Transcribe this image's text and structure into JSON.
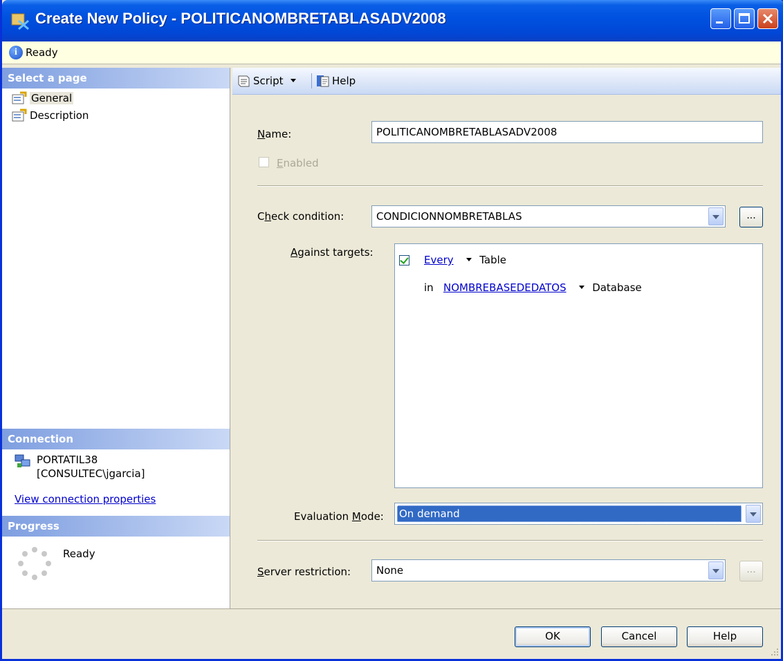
{
  "window": {
    "title": "Create New Policy - POLITICANOMBRETABLASADV2008",
    "status": "Ready"
  },
  "sidebar": {
    "select_page_header": "Select a page",
    "pages": [
      {
        "label": "General",
        "selected": true
      },
      {
        "label": "Description",
        "selected": false
      }
    ],
    "connection_header": "Connection",
    "connection_server": "PORTATIL38",
    "connection_user": "[CONSULTEC\\jgarcia]",
    "view_connection_link": "View connection properties",
    "progress_header": "Progress",
    "progress_status": "Ready"
  },
  "toolbar": {
    "script_label": "Script",
    "help_label": "Help"
  },
  "form": {
    "name_label": "Name:",
    "name_value": "POLITICANOMBRETABLASADV2008",
    "enabled_label": "Enabled",
    "enabled_checked": false,
    "check_condition_label": "Check condition:",
    "check_condition_value": "CONDICIONNOMBRETABLAS",
    "ellipsis": "...",
    "against_targets_label": "Against targets:",
    "target_every": "Every",
    "target_table": "Table",
    "target_in": "in",
    "target_database_name": "NOMBREBASEDEDATOS",
    "target_database": "Database",
    "evaluation_mode_label": "Evaluation Mode:",
    "evaluation_mode_value": "On demand",
    "server_restriction_label": "Server restriction:",
    "server_restriction_value": "None"
  },
  "buttons": {
    "ok": "OK",
    "cancel": "Cancel",
    "help": "Help"
  },
  "colors": {
    "titlebar": "#0052e0",
    "selection": "#316ac5",
    "link": "#0000cc",
    "section_header": "#7e9ee0"
  }
}
